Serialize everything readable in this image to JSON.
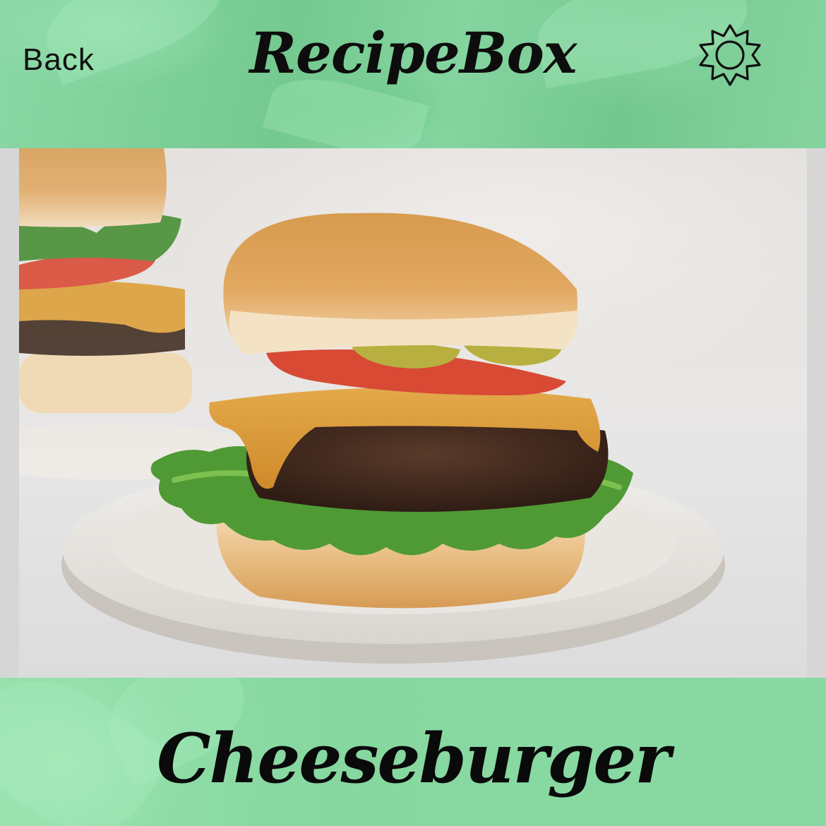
{
  "header": {
    "back_label": "Back",
    "app_title": "RecipeBox",
    "settings_icon": "sun-icon"
  },
  "recipe": {
    "title": "Cheeseburger",
    "image_subject": "cheeseburger-photo"
  },
  "colors": {
    "header_green": "#7fcf98",
    "footer_green": "#8ad9a3",
    "text": "#111111"
  }
}
